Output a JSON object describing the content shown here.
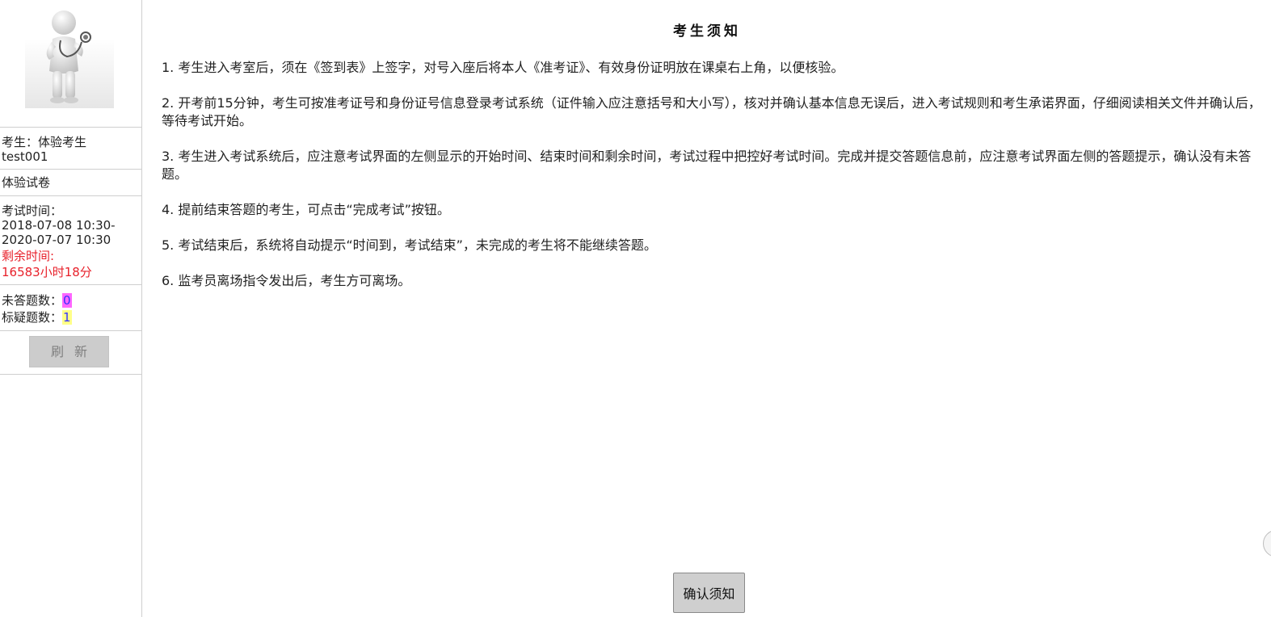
{
  "sidebar": {
    "candidate_line": "考生：体验考生",
    "candidate_id": "test001",
    "paper_name": "体验试卷",
    "exam_time_label": "考试时间：",
    "exam_time_start": "2018-07-08 10:30-",
    "exam_time_end": "2020-07-07 10:30",
    "remaining_label": "剩余时间:",
    "remaining_value": "16583小时18分",
    "unanswered_label": "未答题数：",
    "unanswered_value": "0",
    "flagged_label": "标疑题数：",
    "flagged_value": "1",
    "refresh_label": "刷新"
  },
  "main": {
    "title": "考生须知",
    "rules": [
      "1. 考生进入考室后，须在《签到表》上签字，对号入座后将本人《准考证》、有效身份证明放在课桌右上角，以便核验。",
      "2. 开考前15分钟，考生可按准考证号和身份证号信息登录考试系统（证件输入应注意括号和大小写），核对并确认基本信息无误后，进入考试规则和考生承诺界面，仔细阅读相关文件并确认后，等待考试开始。",
      "3. 考生进入考试系统后，应注意考试界面的左侧显示的开始时间、结束时间和剩余时间，考试过程中把控好考试时间。完成并提交答题信息前，应注意考试界面左侧的答题提示，确认没有未答题。",
      "4. 提前结束答题的考生，可点击“完成考试”按钮。",
      "5. 考试结束后，系统将自动提示“时间到，考试结束”，未完成的考生将不能继续答题。",
      "6. 监考员离场指令发出后，考生方可离场。"
    ],
    "confirm_label": "确认须知"
  },
  "colors": {
    "remaining_time": "#e8212b",
    "unanswered_highlight": "#ff66ff",
    "flagged_highlight": "#ffff88",
    "button_gray": "#cccccc"
  }
}
